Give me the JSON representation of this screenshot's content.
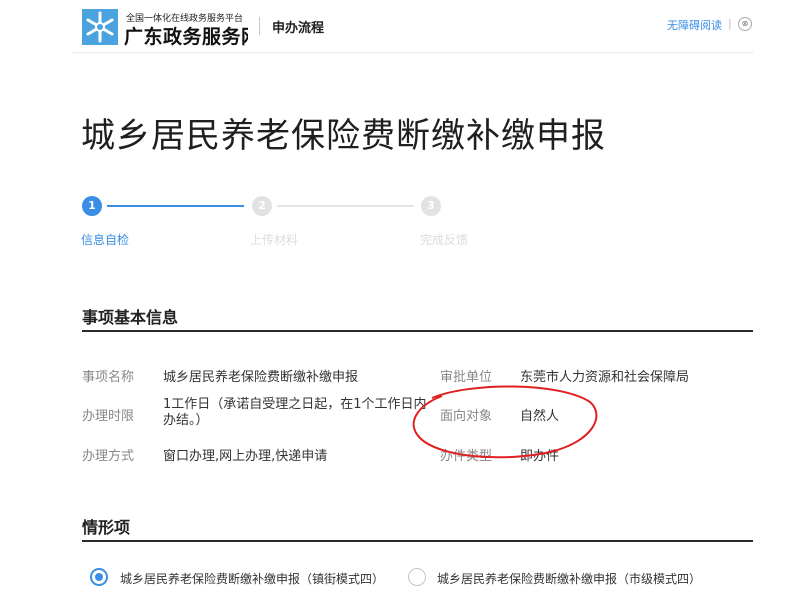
{
  "header": {
    "brand_sub": "全国一体化在线政务服务平台",
    "brand_main": "广东政务服务网",
    "nav_title": "申办流程",
    "accessibility_link": "无障碍阅读",
    "separator": "|",
    "user_icon_glyph": "⊗"
  },
  "page": {
    "title": "城乡居民养老保险费断缴补缴申报"
  },
  "steps": [
    {
      "number": "1",
      "label": "信息自检",
      "active": true
    },
    {
      "number": "2",
      "label": "上传材料",
      "active": false
    },
    {
      "number": "3",
      "label": "完成反馈",
      "active": false
    }
  ],
  "basic_info": {
    "section_title": "事项基本信息",
    "rows": [
      {
        "label": "事项名称",
        "value": "城乡居民养老保险费断缴补缴申报"
      },
      {
        "label": "审批单位",
        "value": "东莞市人力资源和社会保障局"
      },
      {
        "label": "办理时限",
        "value": "1工作日（承诺自受理之日起，在1个工作日内办结。）"
      },
      {
        "label": "面向对象",
        "value": "自然人"
      },
      {
        "label": "办理方式",
        "value": "窗口办理,网上办理,快递申请"
      },
      {
        "label": "办件类型",
        "value": "即办件"
      }
    ]
  },
  "situations": {
    "section_title": "情形项",
    "options": [
      {
        "label": "城乡居民养老保险费断缴补缴申报（镇街模式四）",
        "checked": true
      },
      {
        "label": "城乡居民养老保险费断缴补缴申报（市级模式四）",
        "checked": false
      }
    ]
  },
  "colors": {
    "accent": "#3a8ee6",
    "annotation": "#e02020",
    "logo": "#4aa3df"
  },
  "icons": {
    "logo": "snowflake-logo-icon",
    "user": "user-circle-icon",
    "radio_checked": "radio-checked-icon",
    "radio_unchecked": "radio-unchecked-icon"
  }
}
